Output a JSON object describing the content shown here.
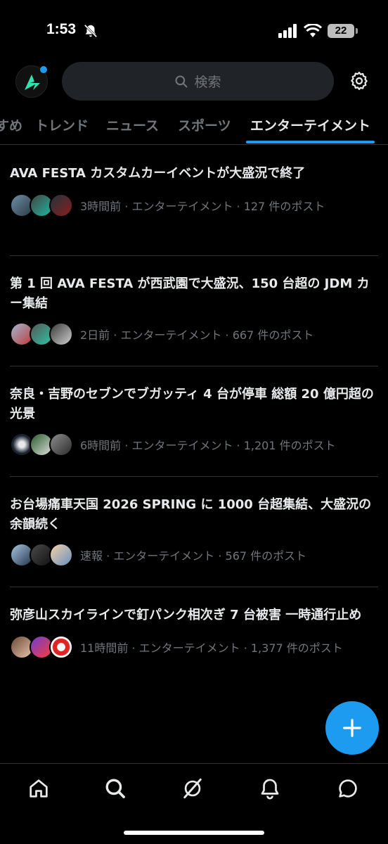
{
  "status_bar": {
    "time": "1:53",
    "battery": "22"
  },
  "header": {
    "search_placeholder": "検索"
  },
  "tabs": [
    {
      "label": "すめ"
    },
    {
      "label": "トレンド"
    },
    {
      "label": "ニュース"
    },
    {
      "label": "スポーツ"
    },
    {
      "label": "エンターテイメント",
      "active": true
    }
  ],
  "trends": [
    {
      "title": "AVA FESTA カスタムカーイベントが大盛況で終了",
      "meta": "3時間前 · エンターテイメント · 127 件のポスト"
    },
    {
      "title": "第 1 回 AVA FESTA が西武園で大盛況、150 台超の JDM カー集結",
      "meta": "2日前 · エンターテイメント · 667 件のポスト"
    },
    {
      "title": "奈良・吉野のセブンでブガッティ 4 台が停車 総額 20 億円超の光景",
      "meta": "6時間前 · エンターテイメント · 1,201 件のポスト"
    },
    {
      "title": "お台場痛車天国 2026 SPRING に 1000 台超集結、大盛況の余韻続く",
      "meta": "速報 · エンターテイメント · 567 件のポスト"
    },
    {
      "title": "弥彦山スカイラインで釘パンク相次ぎ 7 台被害 一時通行止め",
      "meta": "11時間前 · エンターテイメント · 1,377 件のポスト"
    }
  ],
  "colors": {
    "accent": "#1d9bf0",
    "background": "#000000",
    "muted": "#71767b"
  },
  "icons": {
    "nav": [
      "home-icon",
      "search-icon",
      "grok-icon",
      "notifications-icon",
      "messages-icon"
    ]
  }
}
